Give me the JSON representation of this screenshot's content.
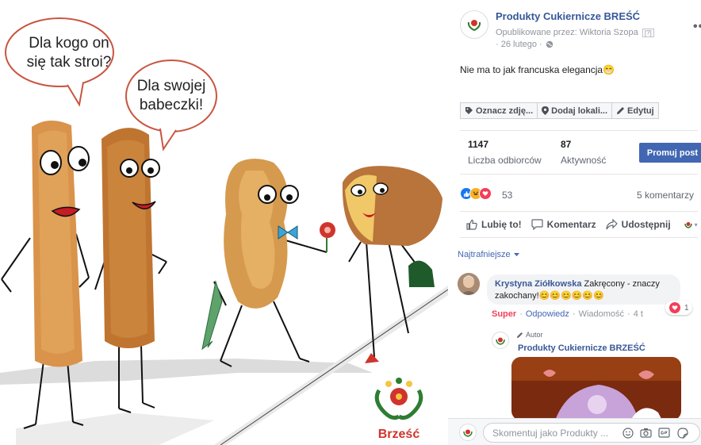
{
  "image": {
    "bubble_left_text": "Dla kogo on\nsię tak stroi?",
    "bubble_right_text": "Dla swojej\nbabeczki!",
    "watermark_brand": "Brześć",
    "colors": {
      "bubble_border": "#c95541",
      "brand_red": "#d0342c",
      "brand_green": "#2e7d32",
      "pastry": "#d9934a"
    }
  },
  "post": {
    "page_name": "Produkty Cukiernicze BREŚĆ",
    "published_by": "Opublikowane przez: Wiktoria Szopa",
    "published_qmark": "[?]",
    "date": "· 26 lutego ·",
    "text": "Nie ma to jak francuska elegancja😁",
    "more_label": "•••"
  },
  "tools": {
    "tag_label": "Oznacz zdję...",
    "location_label": "Dodaj lokali...",
    "edit_label": "Edytuj"
  },
  "stats": {
    "reach_value": "1147",
    "reach_label": "Liczba odbiorców",
    "engagement_value": "87",
    "engagement_label": "Aktywność",
    "promote_label": "Promuj post"
  },
  "reactions": {
    "count": "53",
    "comments_label": "5 komentarzy"
  },
  "actions": {
    "like_label": "Lubię to!",
    "comment_label": "Komentarz",
    "share_label": "Udostępnij",
    "page_caret": "▾"
  },
  "comments": {
    "sort_label": "Najtrafniejsze",
    "first": {
      "author": "Krystyna Ziółkowska",
      "text": "Zakręcony - znaczy zakochany!😊😊😊😊😊😊",
      "reaction_count": "1",
      "super_label": "Super",
      "reply_label": "Odpowiedz",
      "message_label": "Wiadomość",
      "time": "4 t",
      "sep": "·"
    },
    "reply": {
      "badge": "Autor",
      "author": "Produkty Cukiernicze BRZEŚĆ"
    },
    "composer_placeholder": "Skomentuj jako Produkty ..."
  }
}
